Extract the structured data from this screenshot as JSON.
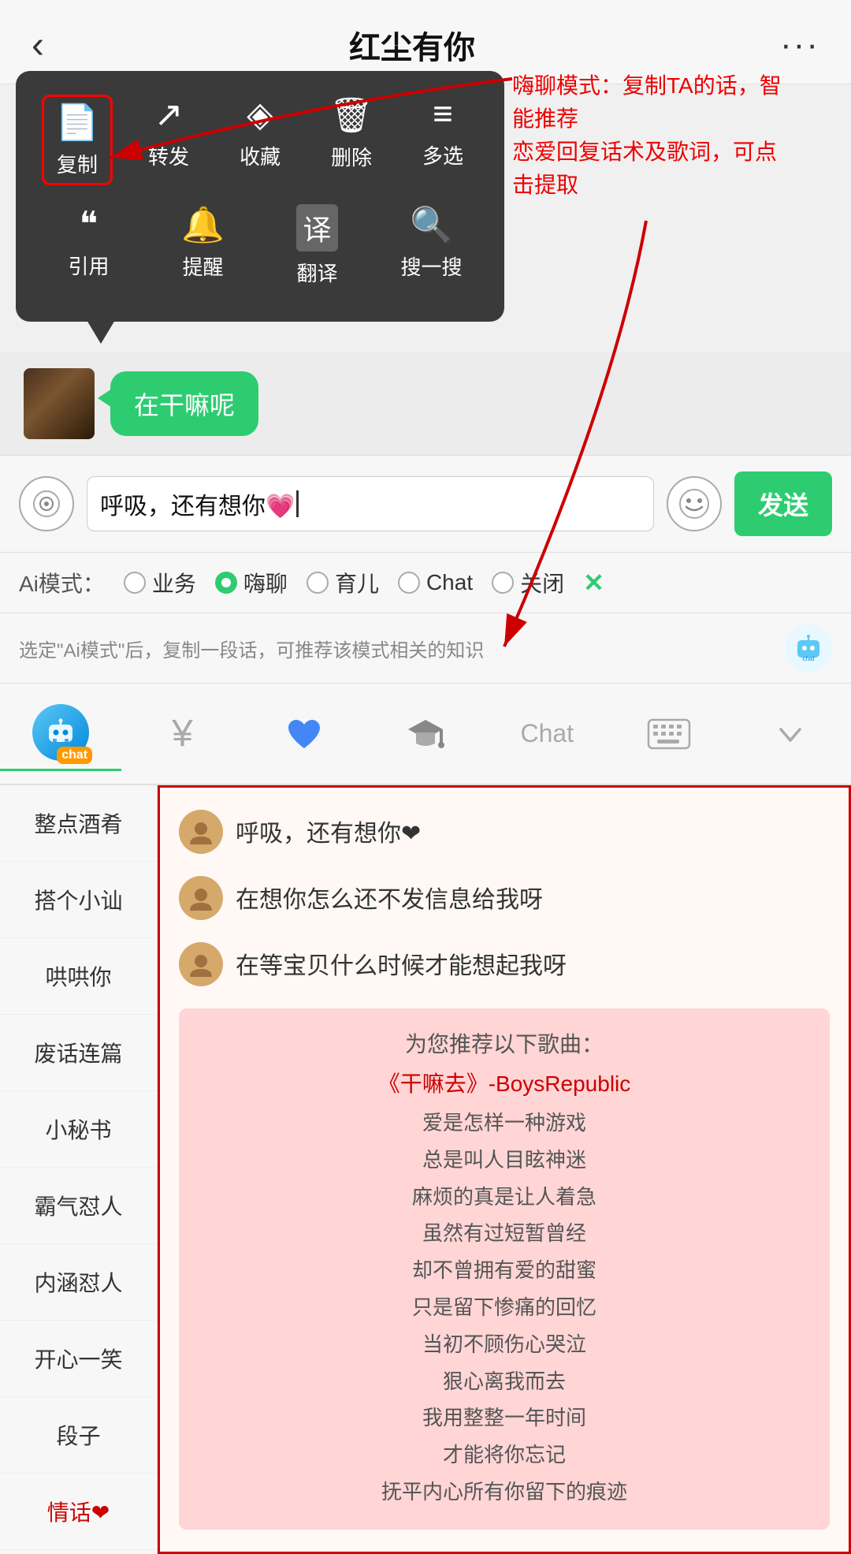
{
  "header": {
    "back_label": "‹",
    "title": "红尘有你",
    "more_label": "···"
  },
  "context_menu": {
    "row1": [
      {
        "icon": "📄",
        "label": "复制",
        "highlighted": true
      },
      {
        "icon": "↗",
        "label": "转发",
        "highlighted": false
      },
      {
        "icon": "◈",
        "label": "收藏",
        "highlighted": false
      },
      {
        "icon": "🗑",
        "label": "删除",
        "highlighted": false
      },
      {
        "icon": "≡",
        "label": "多选",
        "highlighted": false
      }
    ],
    "row2": [
      {
        "icon": "❝",
        "label": "引用",
        "highlighted": false
      },
      {
        "icon": "🔔",
        "label": "提醒",
        "highlighted": false
      },
      {
        "icon": "译",
        "label": "翻译",
        "highlighted": false
      },
      {
        "icon": "🔍",
        "label": "搜一搜",
        "highlighted": false
      }
    ]
  },
  "annotation": {
    "text": "嗨聊模式：复制TA的话，智能推荐\n恋爱回复话术及歌词，可点击提取"
  },
  "chat_bubble": {
    "text": "在干嘛呢"
  },
  "input": {
    "value": "呼吸，还有想你💗",
    "send_label": "发送"
  },
  "ai_modes": {
    "label": "Ai模式：",
    "options": [
      {
        "label": "业务",
        "selected": false
      },
      {
        "label": "嗨聊",
        "selected": true
      },
      {
        "label": "育儿",
        "selected": false
      },
      {
        "label": "Chat",
        "selected": false
      },
      {
        "label": "关闭",
        "selected": false
      }
    ],
    "close_label": "✕"
  },
  "hint": {
    "text": "选定\"Ai模式\"后，复制一段话，可推荐该模式相关的知识"
  },
  "toolbar": {
    "items": [
      {
        "label": "🤖",
        "type": "chat",
        "badge": "chat"
      },
      {
        "label": "¥",
        "type": "money"
      },
      {
        "label": "♥",
        "type": "heart"
      },
      {
        "label": "🎓",
        "type": "graduation"
      },
      {
        "label": "Chat",
        "type": "text"
      },
      {
        "label": "⌨",
        "type": "keyboard"
      },
      {
        "label": "▼",
        "type": "down"
      }
    ]
  },
  "sidebar": {
    "items": [
      {
        "label": "整点酒肴"
      },
      {
        "label": "搭个小讪"
      },
      {
        "label": "哄哄你"
      },
      {
        "label": "废话连篇"
      },
      {
        "label": "小秘书"
      },
      {
        "label": "霸气怼人"
      },
      {
        "label": "内涵怼人"
      },
      {
        "label": "开心一笑"
      },
      {
        "label": "段子"
      },
      {
        "label": "情话❤",
        "special": true
      }
    ]
  },
  "responses": [
    {
      "text": "呼吸，还有想你❤"
    },
    {
      "text": "在想你怎么还不发信息给我呀"
    },
    {
      "text": "在等宝贝什么时候才能想起我呀"
    }
  ],
  "song_section": {
    "title": "为您推荐以下歌曲：",
    "main_song": "《干嘛去》-BoysRepublic",
    "lyrics": [
      "爱是怎样一种游戏",
      "总是叫人目眩神迷",
      "麻烦的真是让人着急",
      "虽然有过短暂曾经",
      "却不曾拥有爱的甜蜜",
      "只是留下惨痛的回忆",
      "当初不顾伤心哭泣",
      "狠心离我而去",
      "我用整整一年时间",
      "才能将你忘记",
      "抚平内心所有你留下的痕迹"
    ]
  }
}
